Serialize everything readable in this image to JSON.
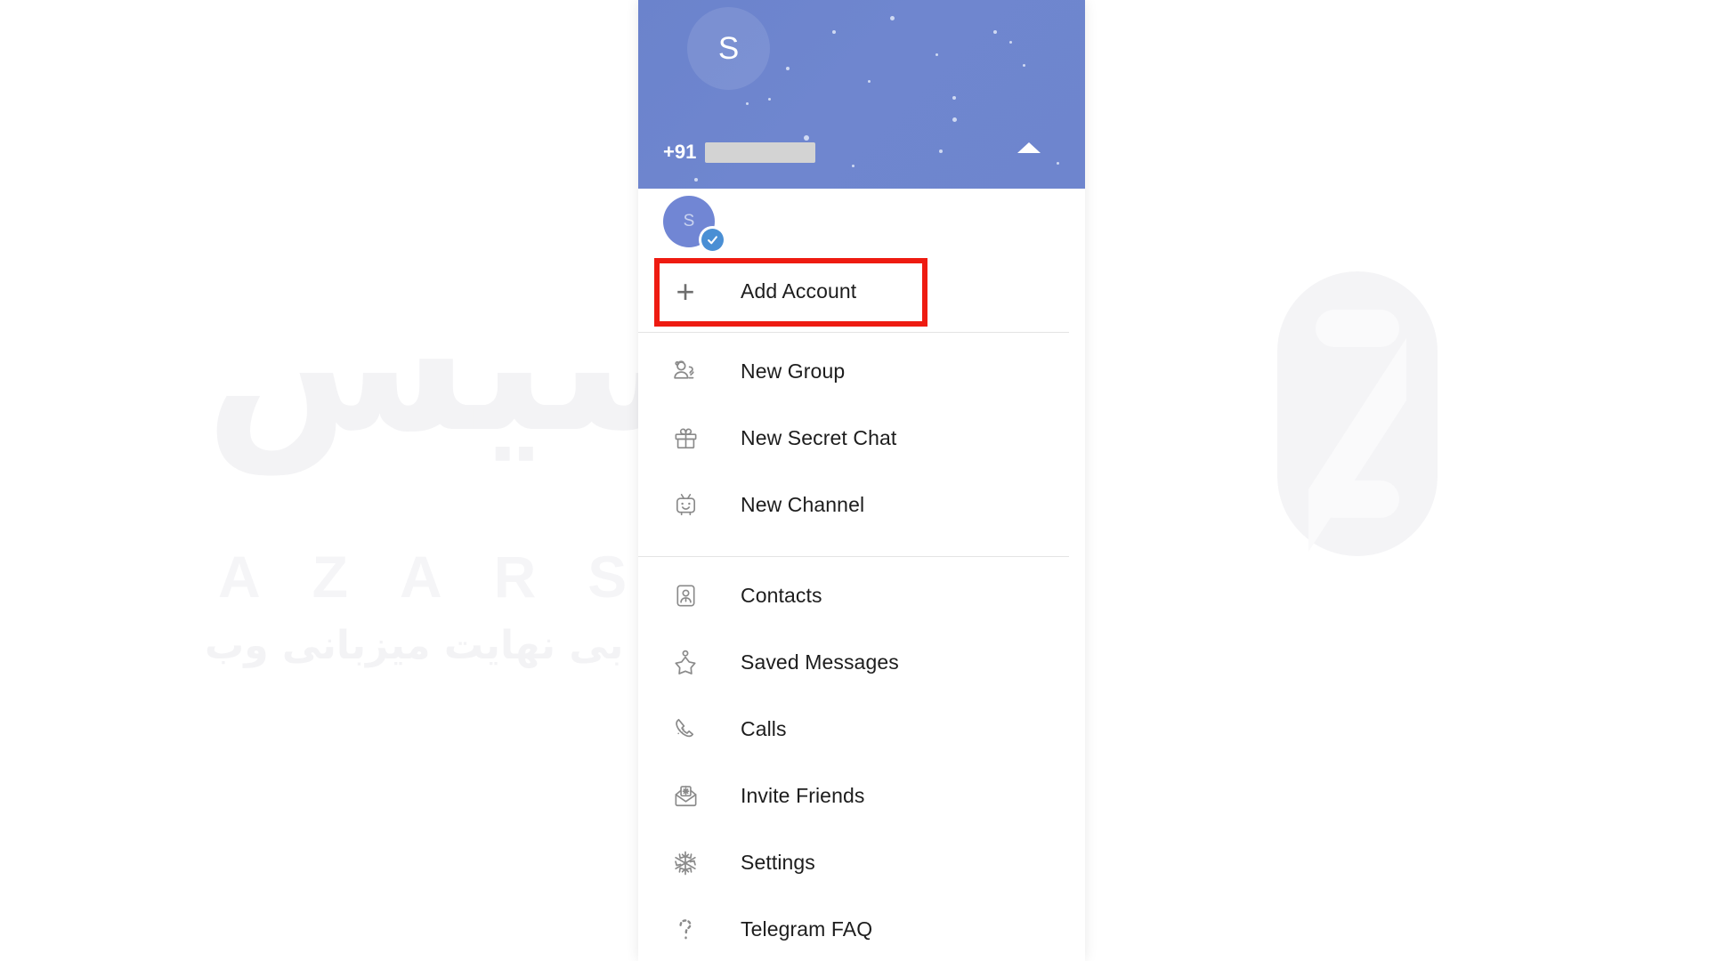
{
  "app": {
    "name": "Telegram",
    "screen": "navigation-drawer"
  },
  "watermark": {
    "persian_brand": "آذرسیس",
    "latin_brand": "AZARSYS",
    "persian_tagline": "سرعت بی نهایت میزبانی وب",
    "logo_letter": "S",
    "color": "#f3f3f5"
  },
  "header": {
    "avatar_initial": "S",
    "phone_country_code": "+91",
    "phone_number_redacted": true,
    "expand_accounts_icon": "chevron-up-icon",
    "background_color": "#6e85ce"
  },
  "account": {
    "avatar_initial": "S",
    "selected": true,
    "check_icon": "check-badge-icon"
  },
  "highlight": {
    "target": "Add Account",
    "color": "#ee1b11"
  },
  "menu": {
    "add_account": {
      "label": "Add Account",
      "icon": "plus-icon"
    },
    "groups": [
      {
        "items": [
          {
            "label": "New Group",
            "icon": "new-group-icon"
          },
          {
            "label": "New Secret Chat",
            "icon": "gift-icon"
          },
          {
            "label": "New Channel",
            "icon": "tv-face-icon"
          }
        ]
      },
      {
        "items": [
          {
            "label": "Contacts",
            "icon": "contacts-icon"
          },
          {
            "label": "Saved Messages",
            "icon": "star-icon"
          },
          {
            "label": "Calls",
            "icon": "phone-icon"
          },
          {
            "label": "Invite Friends",
            "icon": "envelope-icon"
          },
          {
            "label": "Settings",
            "icon": "snowflake-icon"
          },
          {
            "label": "Telegram FAQ",
            "icon": "question-mark-icon"
          }
        ]
      }
    ]
  }
}
